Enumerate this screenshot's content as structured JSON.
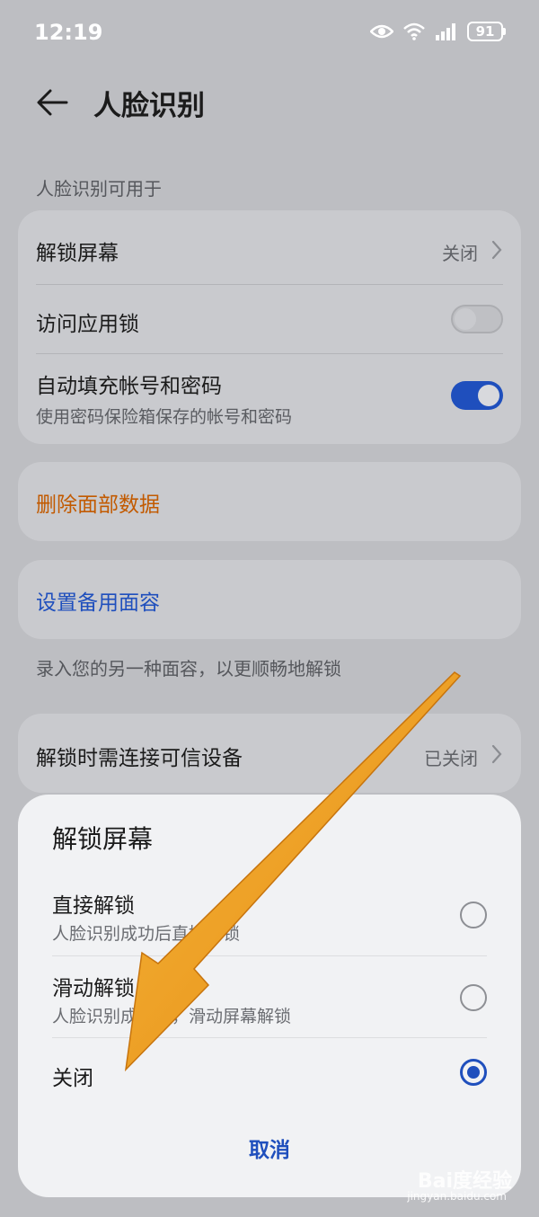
{
  "status": {
    "time": "12:19",
    "battery": "91",
    "icons": [
      "eye-icon",
      "wifi-icon",
      "signal-icon",
      "battery-icon"
    ]
  },
  "header": {
    "title": "人脸识别"
  },
  "section_caption": "人脸识别可用于",
  "usage": {
    "unlock_screen": {
      "label": "解锁屏幕",
      "value": "关闭"
    },
    "app_lock": {
      "label": "访问应用锁",
      "enabled": false
    },
    "autofill": {
      "label": "自动填充帐号和密码",
      "sub": "使用密码保险箱保存的帐号和密码",
      "enabled": true
    }
  },
  "delete_face": {
    "label": "删除面部数据",
    "color": "#c25a00"
  },
  "backup_face": {
    "label": "设置备用面容",
    "color": "#1f4fbd",
    "caption": "录入您的另一种面容，以更顺畅地解锁"
  },
  "trusted_device": {
    "label": "解锁时需连接可信设备",
    "value": "已关闭"
  },
  "sheet": {
    "title": "解锁屏幕",
    "options": [
      {
        "label": "直接解锁",
        "sub": "人脸识别成功后直接解锁",
        "selected": false
      },
      {
        "label": "滑动解锁",
        "sub": "人脸识别成功后，滑动屏幕解锁",
        "selected": false
      },
      {
        "label": "关闭",
        "sub": "",
        "selected": true
      }
    ],
    "cancel": "取消"
  },
  "watermark": {
    "brand": "Bai度经验",
    "url": "jingyan.baidu.com"
  },
  "colors": {
    "accent": "#1f4fbd",
    "warning": "#c25a00",
    "annotation_arrow": "#f0a020"
  }
}
